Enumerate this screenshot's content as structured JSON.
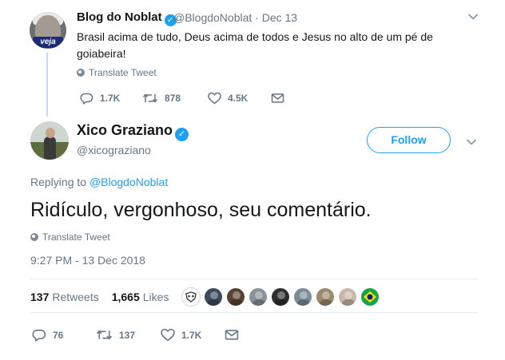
{
  "parent_tweet": {
    "author_name": "Blog do Noblat",
    "author_handle": "@BlogdoNoblat",
    "date": "Dec 13",
    "avatar_badge": "veja",
    "text": "Brasil acima de tudo, Deus acima de todos e Jesus no alto de um pé de goiabeira!",
    "translate_label": "Translate Tweet",
    "actions": {
      "replies": "1.7K",
      "retweets": "878",
      "likes": "4.5K"
    }
  },
  "main_tweet": {
    "author_name": "Xico Graziano",
    "author_handle": "@xicograziano",
    "follow_label": "Follow",
    "replying_prefix": "Replying to",
    "replying_to": "@BlogdoNoblat",
    "text": "Ridículo, vergonhoso, seu comentário.",
    "translate_label": "Translate Tweet",
    "timestamp": "9:27 PM - 13 Dec 2018",
    "stats": {
      "retweets_count": "137",
      "retweets_label": "Retweets",
      "likes_count": "1,665",
      "likes_label": "Likes"
    },
    "liker_avatars": [
      {
        "icon": "mask-icon",
        "color": "#ffffff"
      },
      {
        "icon": "avatar",
        "color": "#3b4a5c"
      },
      {
        "icon": "avatar",
        "color": "#5a4232"
      },
      {
        "icon": "avatar",
        "color": "#8a9199"
      },
      {
        "icon": "avatar",
        "color": "#2e2e2e"
      },
      {
        "icon": "avatar",
        "color": "#7a8c96"
      },
      {
        "icon": "avatar",
        "color": "#9b8a6e"
      },
      {
        "icon": "avatar",
        "color": "#c9b8a8"
      },
      {
        "icon": "brazil-flag-icon",
        "color": "#19a34a"
      }
    ],
    "actions": {
      "replies": "76",
      "retweets": "137",
      "likes": "1.7K"
    }
  },
  "colors": {
    "accent": "#1da1f2",
    "muted": "#657786",
    "text": "#14171a",
    "thread_line": "#b8e1f4",
    "divider": "#e6ecf0"
  }
}
